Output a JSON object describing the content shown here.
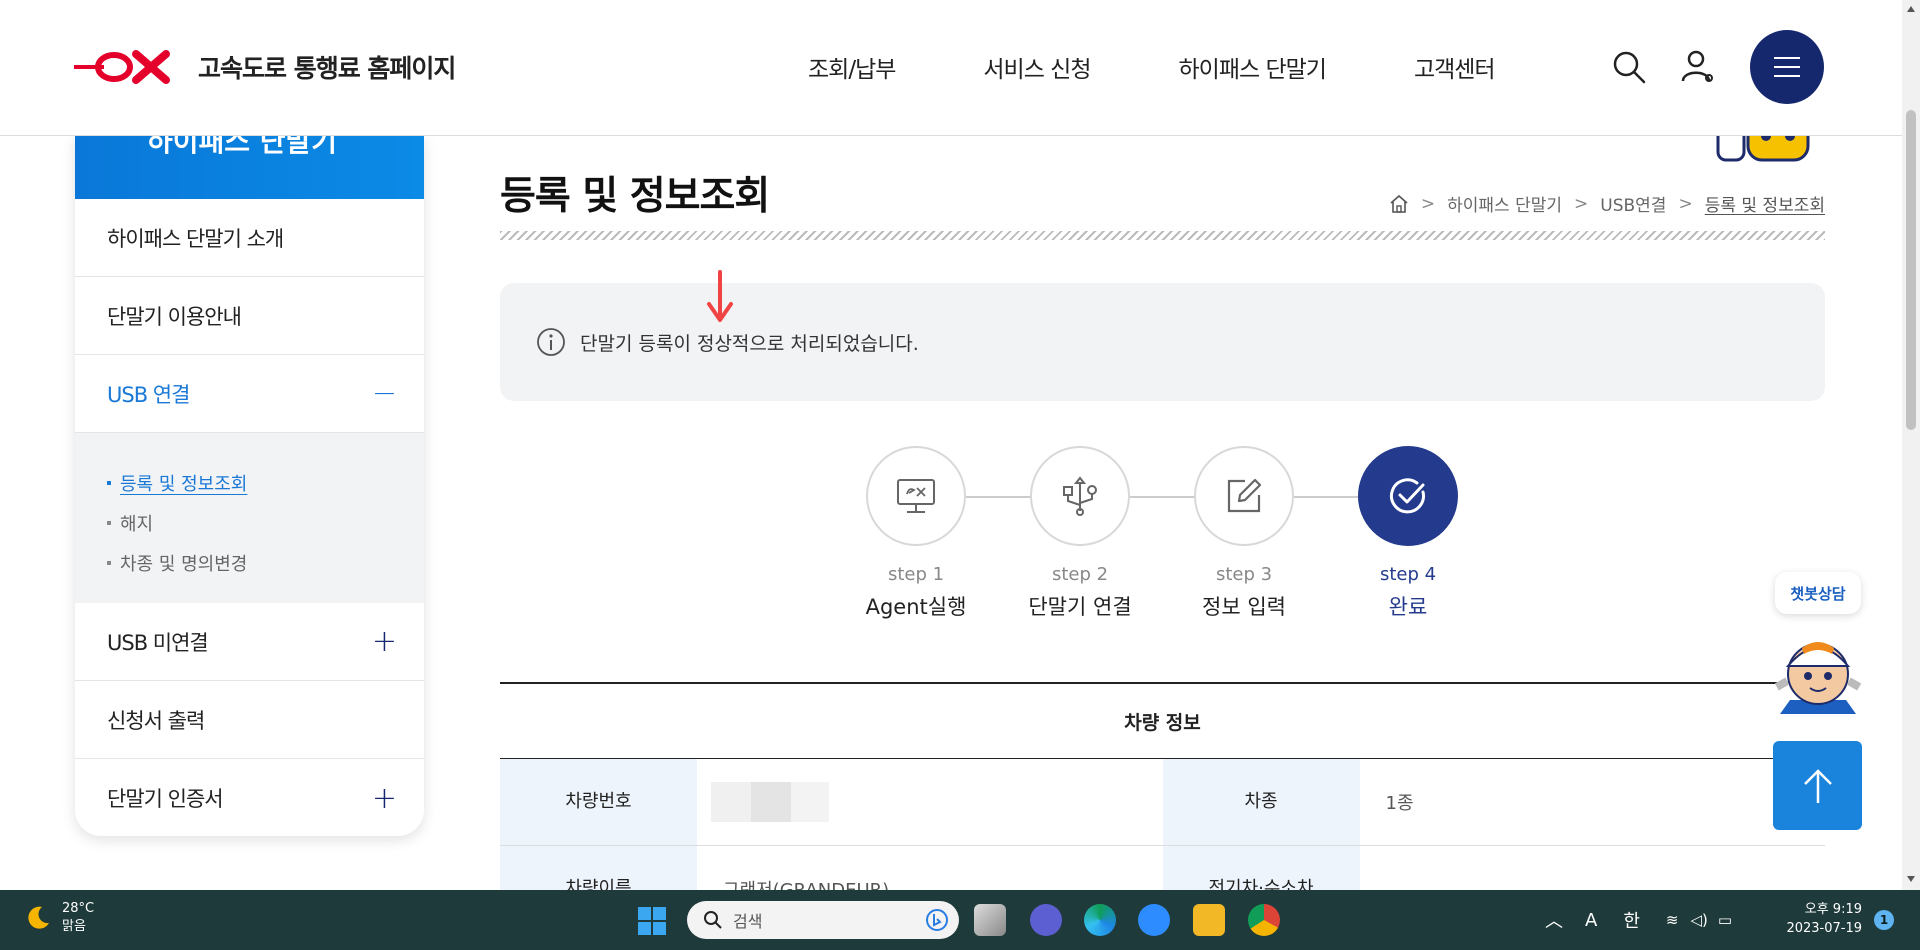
{
  "header": {
    "site_title": "고속도로 통행료 홈페이지",
    "nav": [
      "조회/납부",
      "서비스 신청",
      "하이패스 단말기",
      "고객센터"
    ],
    "icons": [
      "search-icon",
      "user-icon",
      "hamburger-menu-icon"
    ],
    "accent": "#16286d"
  },
  "sidebar": {
    "banner_title": "하이패스 단말기",
    "items": [
      {
        "label": "하이패스 단말기 소개",
        "sign": ""
      },
      {
        "label": "단말기 이용안내",
        "sign": ""
      },
      {
        "label": "USB 연결",
        "sign": "−"
      },
      {
        "label": "USB 미연결",
        "sign": "+"
      },
      {
        "label": "신청서 출력",
        "sign": ""
      },
      {
        "label": "단말기 인증서",
        "sign": "+"
      }
    ],
    "sub_items": [
      "등록 및 정보조회",
      "해지",
      "차종 및 명의변경"
    ],
    "active_color": "#1a78d7"
  },
  "main": {
    "page_title": "등록 및 정보조회",
    "breadcrumb": [
      "하이패스 단말기",
      "USB연결",
      "등록 및 정보조회"
    ],
    "notice": "단말기 등록이 정상적으로 처리되었습니다.",
    "steps": [
      {
        "num": "step 1",
        "label": "Agent실행"
      },
      {
        "num": "step 2",
        "label": "단말기 연결"
      },
      {
        "num": "step 3",
        "label": "정보 입력"
      },
      {
        "num": "step 4",
        "label": "완료"
      }
    ],
    "table": {
      "title": "차량 정보",
      "rows": [
        {
          "th1": "차량번호",
          "td1": "",
          "th2": "차종",
          "td2": "1종"
        },
        {
          "th1": "차량이름",
          "td1": "그랜저(GRANDEUR)",
          "th2": "전기차·수소차",
          "td2": ""
        }
      ]
    }
  },
  "floating": {
    "chat_label": "챗봇상담"
  },
  "taskbar": {
    "weather_temp": "28°C",
    "weather_desc": "맑음",
    "search_placeholder": "검색",
    "tray_a": "A",
    "tray_lang": "한",
    "time": "오후 9:19",
    "date": "2023-07-19",
    "notif_count": "1"
  }
}
